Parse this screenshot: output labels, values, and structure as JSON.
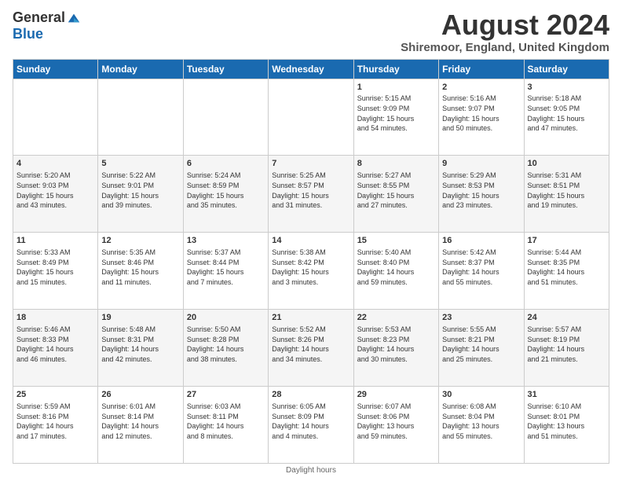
{
  "logo": {
    "general": "General",
    "blue": "Blue"
  },
  "title": "August 2024",
  "location": "Shiremoor, England, United Kingdom",
  "days_of_week": [
    "Sunday",
    "Monday",
    "Tuesday",
    "Wednesday",
    "Thursday",
    "Friday",
    "Saturday"
  ],
  "footer": "Daylight hours",
  "weeks": [
    [
      {
        "day": "",
        "info": ""
      },
      {
        "day": "",
        "info": ""
      },
      {
        "day": "",
        "info": ""
      },
      {
        "day": "",
        "info": ""
      },
      {
        "day": "1",
        "info": "Sunrise: 5:15 AM\nSunset: 9:09 PM\nDaylight: 15 hours\nand 54 minutes."
      },
      {
        "day": "2",
        "info": "Sunrise: 5:16 AM\nSunset: 9:07 PM\nDaylight: 15 hours\nand 50 minutes."
      },
      {
        "day": "3",
        "info": "Sunrise: 5:18 AM\nSunset: 9:05 PM\nDaylight: 15 hours\nand 47 minutes."
      }
    ],
    [
      {
        "day": "4",
        "info": "Sunrise: 5:20 AM\nSunset: 9:03 PM\nDaylight: 15 hours\nand 43 minutes."
      },
      {
        "day": "5",
        "info": "Sunrise: 5:22 AM\nSunset: 9:01 PM\nDaylight: 15 hours\nand 39 minutes."
      },
      {
        "day": "6",
        "info": "Sunrise: 5:24 AM\nSunset: 8:59 PM\nDaylight: 15 hours\nand 35 minutes."
      },
      {
        "day": "7",
        "info": "Sunrise: 5:25 AM\nSunset: 8:57 PM\nDaylight: 15 hours\nand 31 minutes."
      },
      {
        "day": "8",
        "info": "Sunrise: 5:27 AM\nSunset: 8:55 PM\nDaylight: 15 hours\nand 27 minutes."
      },
      {
        "day": "9",
        "info": "Sunrise: 5:29 AM\nSunset: 8:53 PM\nDaylight: 15 hours\nand 23 minutes."
      },
      {
        "day": "10",
        "info": "Sunrise: 5:31 AM\nSunset: 8:51 PM\nDaylight: 15 hours\nand 19 minutes."
      }
    ],
    [
      {
        "day": "11",
        "info": "Sunrise: 5:33 AM\nSunset: 8:49 PM\nDaylight: 15 hours\nand 15 minutes."
      },
      {
        "day": "12",
        "info": "Sunrise: 5:35 AM\nSunset: 8:46 PM\nDaylight: 15 hours\nand 11 minutes."
      },
      {
        "day": "13",
        "info": "Sunrise: 5:37 AM\nSunset: 8:44 PM\nDaylight: 15 hours\nand 7 minutes."
      },
      {
        "day": "14",
        "info": "Sunrise: 5:38 AM\nSunset: 8:42 PM\nDaylight: 15 hours\nand 3 minutes."
      },
      {
        "day": "15",
        "info": "Sunrise: 5:40 AM\nSunset: 8:40 PM\nDaylight: 14 hours\nand 59 minutes."
      },
      {
        "day": "16",
        "info": "Sunrise: 5:42 AM\nSunset: 8:37 PM\nDaylight: 14 hours\nand 55 minutes."
      },
      {
        "day": "17",
        "info": "Sunrise: 5:44 AM\nSunset: 8:35 PM\nDaylight: 14 hours\nand 51 minutes."
      }
    ],
    [
      {
        "day": "18",
        "info": "Sunrise: 5:46 AM\nSunset: 8:33 PM\nDaylight: 14 hours\nand 46 minutes."
      },
      {
        "day": "19",
        "info": "Sunrise: 5:48 AM\nSunset: 8:31 PM\nDaylight: 14 hours\nand 42 minutes."
      },
      {
        "day": "20",
        "info": "Sunrise: 5:50 AM\nSunset: 8:28 PM\nDaylight: 14 hours\nand 38 minutes."
      },
      {
        "day": "21",
        "info": "Sunrise: 5:52 AM\nSunset: 8:26 PM\nDaylight: 14 hours\nand 34 minutes."
      },
      {
        "day": "22",
        "info": "Sunrise: 5:53 AM\nSunset: 8:23 PM\nDaylight: 14 hours\nand 30 minutes."
      },
      {
        "day": "23",
        "info": "Sunrise: 5:55 AM\nSunset: 8:21 PM\nDaylight: 14 hours\nand 25 minutes."
      },
      {
        "day": "24",
        "info": "Sunrise: 5:57 AM\nSunset: 8:19 PM\nDaylight: 14 hours\nand 21 minutes."
      }
    ],
    [
      {
        "day": "25",
        "info": "Sunrise: 5:59 AM\nSunset: 8:16 PM\nDaylight: 14 hours\nand 17 minutes."
      },
      {
        "day": "26",
        "info": "Sunrise: 6:01 AM\nSunset: 8:14 PM\nDaylight: 14 hours\nand 12 minutes."
      },
      {
        "day": "27",
        "info": "Sunrise: 6:03 AM\nSunset: 8:11 PM\nDaylight: 14 hours\nand 8 minutes."
      },
      {
        "day": "28",
        "info": "Sunrise: 6:05 AM\nSunset: 8:09 PM\nDaylight: 14 hours\nand 4 minutes."
      },
      {
        "day": "29",
        "info": "Sunrise: 6:07 AM\nSunset: 8:06 PM\nDaylight: 13 hours\nand 59 minutes."
      },
      {
        "day": "30",
        "info": "Sunrise: 6:08 AM\nSunset: 8:04 PM\nDaylight: 13 hours\nand 55 minutes."
      },
      {
        "day": "31",
        "info": "Sunrise: 6:10 AM\nSunset: 8:01 PM\nDaylight: 13 hours\nand 51 minutes."
      }
    ]
  ]
}
